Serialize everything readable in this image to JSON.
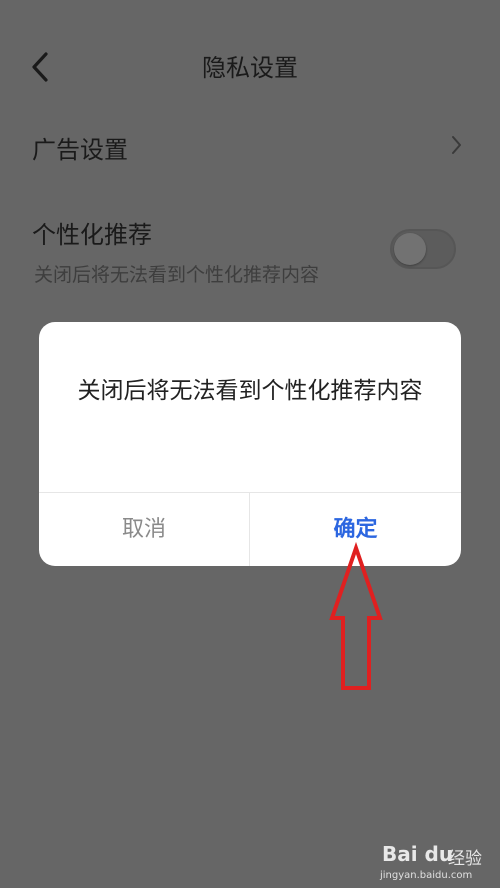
{
  "header": {
    "title": "隐私设置",
    "back_icon": "chevron-left-icon"
  },
  "settings": {
    "ad": {
      "label": "广告设置",
      "icon": "chevron-right-icon"
    },
    "personalized": {
      "label": "个性化推荐",
      "description": "关闭后将无法看到个性化推荐内容",
      "toggle_on": true
    }
  },
  "dialog": {
    "message": "关闭后将无法看到个性化推荐内容",
    "cancel_label": "取消",
    "confirm_label": "确定",
    "confirm_color": "#2c66e0"
  },
  "annotation": {
    "arrow_color": "#e02020"
  },
  "watermark": {
    "logo": "Bai du",
    "brand": "经验",
    "url": "jingyan.baidu.com"
  },
  "colors": {
    "overlay": "#666666",
    "dialog_bg": "#ffffff"
  }
}
